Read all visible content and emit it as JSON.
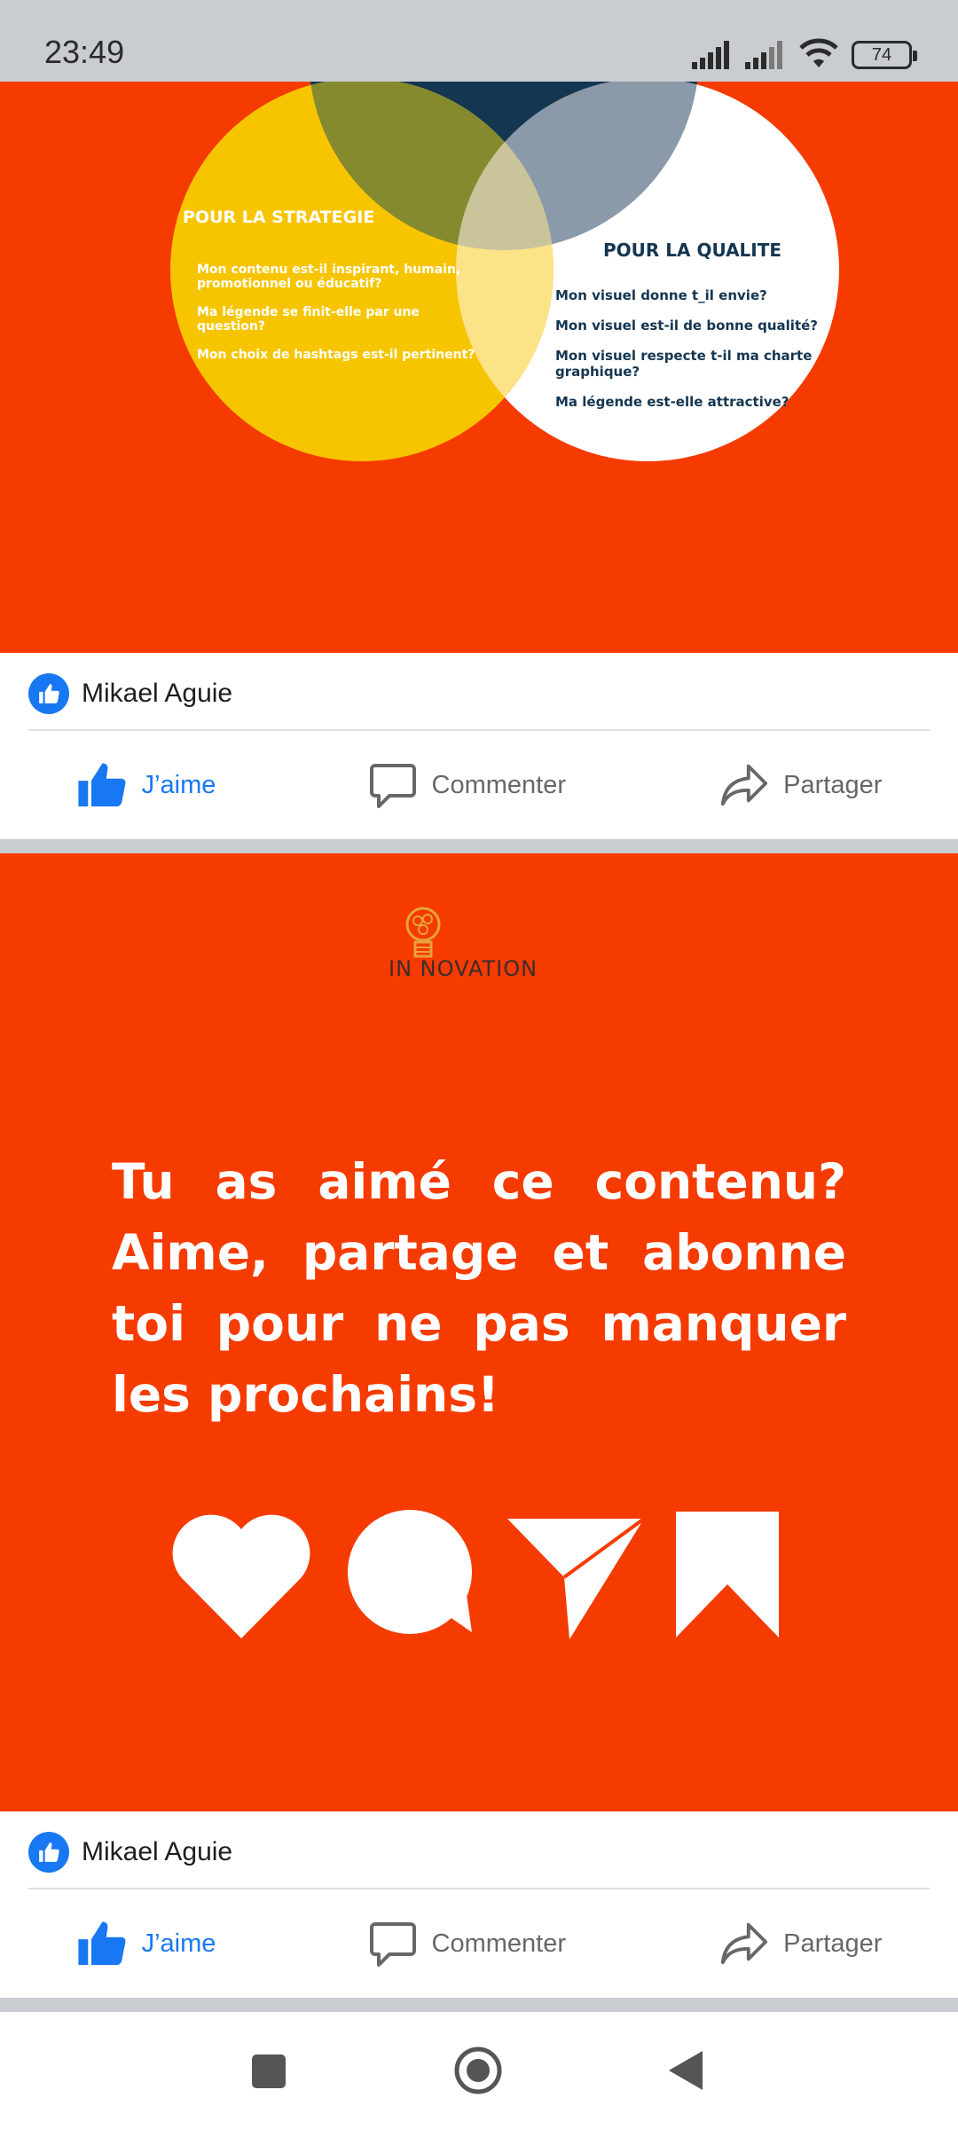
{
  "status_bar": {
    "time": "23:49",
    "battery": "74",
    "icons": [
      "signal-icon",
      "signal-icon",
      "wifi-icon",
      "battery-icon"
    ]
  },
  "posts": [
    {
      "venn": {
        "left_title": "POUR LA STRATEGIE",
        "left_items": [
          "Mon contenu est-il inspirant, humain,",
          "promotionnel ou éducatif?",
          "Ma légende se finit-elle par une",
          "question?",
          "Mon choix de hashtags est-il pertinent?"
        ],
        "right_title": "POUR LA QUALITE",
        "right_items": [
          "Mon visuel donne t_il envie?",
          "Mon visuel est-il de bonne qualité?",
          "Mon visuel respecte t-il ma charte",
          "graphique?",
          "Ma légende est-elle attractive?"
        ]
      },
      "reaction_name": "Mikael Aguie",
      "actions": {
        "like": "J’aime",
        "comment": "Commenter",
        "share": "Partager"
      }
    },
    {
      "logo_text": "IN NOVATION",
      "promo_text": "Tu as aimé ce contenu? Aime, partage et abonne toi pour ne pas manquer les prochains!",
      "reaction_name": "Mikael Aguie",
      "actions": {
        "like": "J’aime",
        "comment": "Commenter",
        "share": "Partager"
      }
    }
  ],
  "colors": {
    "post_background": "#f53b00",
    "facebook_blue": "#1877f2",
    "venn_yellow": "#f7c500",
    "venn_navy": "#143651"
  },
  "nav_bar": {
    "icons": [
      "recent-apps-icon",
      "home-icon",
      "back-icon"
    ]
  }
}
